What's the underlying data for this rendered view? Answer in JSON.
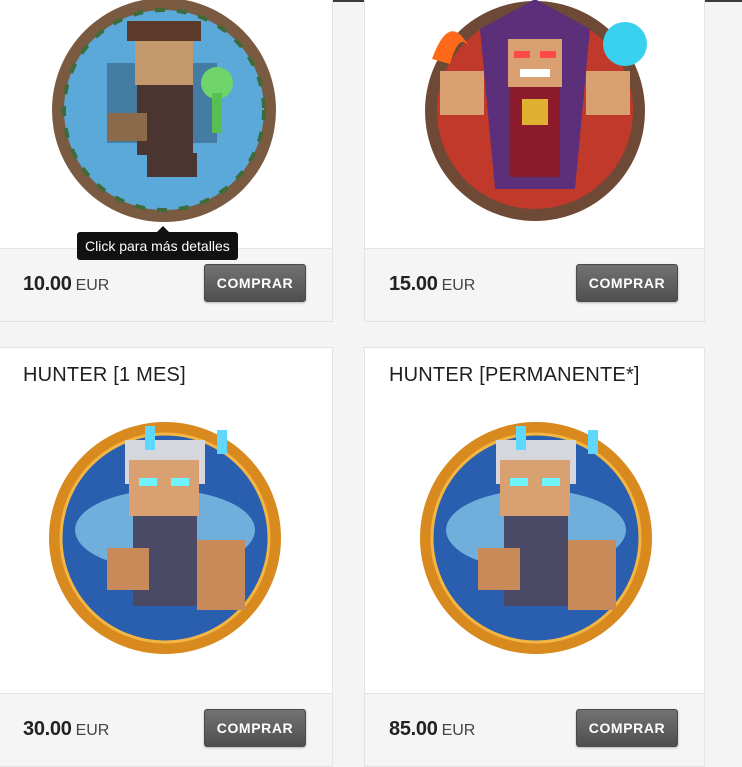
{
  "tooltip": {
    "text": "Click para más detalles"
  },
  "products": [
    {
      "title": "",
      "price": "10.00",
      "currency": "EUR",
      "buy_label": "COMPRAR",
      "art": "wizard-alchemist"
    },
    {
      "title": "",
      "price": "15.00",
      "currency": "EUR",
      "buy_label": "COMPRAR",
      "art": "fire-ice-wizard"
    },
    {
      "title": "HUNTER [1 MES]",
      "price": "30.00",
      "currency": "EUR",
      "buy_label": "COMPRAR",
      "art": "hunter-rank"
    },
    {
      "title": "HUNTER [PERMANENTE*]",
      "price": "85.00",
      "currency": "EUR",
      "buy_label": "COMPRAR",
      "art": "hunter-rank"
    }
  ],
  "colors": {
    "button": "#5e5e5e",
    "card_bg": "#ffffff",
    "footer_bg": "#f5f5f5",
    "page_bg": "#f4f4f4",
    "hunter_frame": "#d88a1e",
    "wizard_frame": "#7a5a40"
  }
}
